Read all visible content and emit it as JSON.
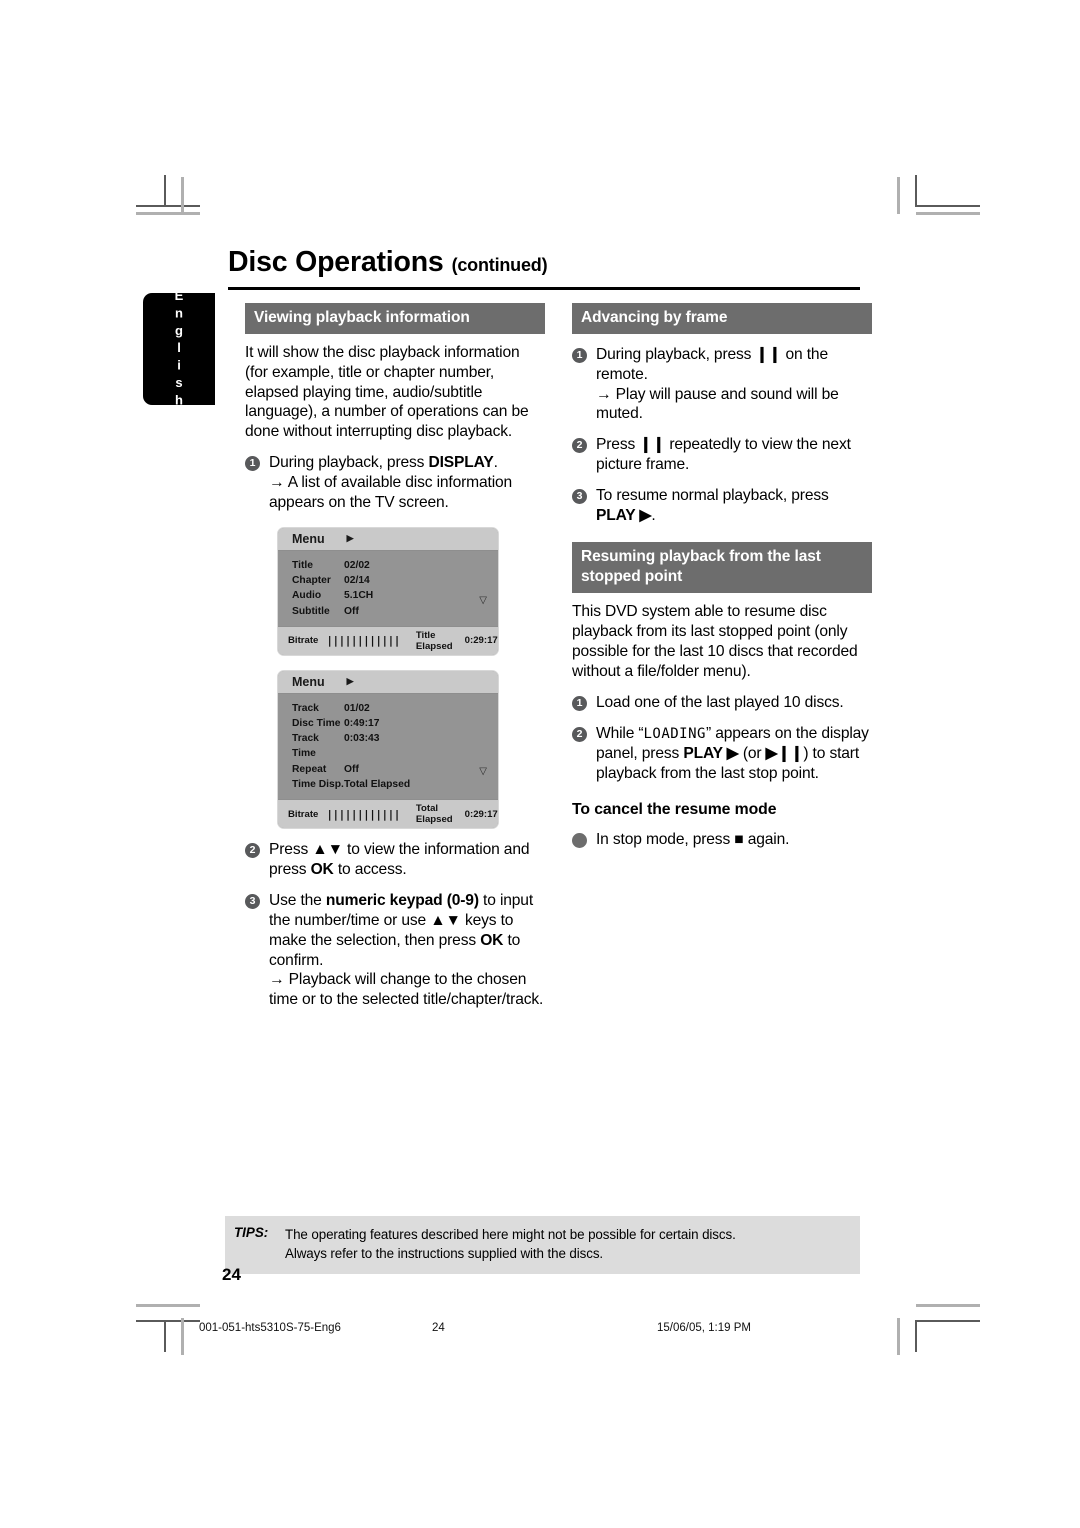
{
  "page": {
    "title_main": "Disc Operations",
    "title_cont": "(continued)",
    "language_tab": "English",
    "folio": "24"
  },
  "left_column": {
    "section_heading": "Viewing playback information",
    "intro": "It will show the disc playback information (for example, title or chapter number, elapsed playing time, audio/subtitle language), a number of operations can be done without interrupting disc playback.",
    "steps": [
      {
        "marker": "1",
        "text_parts": [
          {
            "t": "During playback, press ",
            "bold": false
          },
          {
            "t": "DISPLAY",
            "bold": true
          },
          {
            "t": ".",
            "bold": false
          }
        ],
        "sub": "→ A list of available disc information appears on the TV screen."
      },
      {
        "marker": "2",
        "text_parts": [
          {
            "t": "Press ",
            "bold": false
          },
          {
            "t": "▲▼",
            "bold": false
          },
          {
            "t": "  to view the information and press ",
            "bold": false
          },
          {
            "t": "OK",
            "bold": true
          },
          {
            "t": " to access.",
            "bold": false
          }
        ],
        "sub": ""
      },
      {
        "marker": "3",
        "text_parts": [
          {
            "t": "Use the ",
            "bold": false
          },
          {
            "t": "numeric keypad (0-9)",
            "bold": true
          },
          {
            "t": " to input the number/time or use ▲▼ keys to make the selection, then press ",
            "bold": false
          },
          {
            "t": "OK",
            "bold": true
          },
          {
            "t": " to confirm.",
            "bold": false
          }
        ],
        "sub": "→ Playback will change to the chosen time or to the selected title/chapter/track."
      }
    ],
    "osd_boxes": [
      {
        "header": "Menu",
        "header_arrow": "▶",
        "rows": [
          {
            "key": "Title",
            "value": "02/02"
          },
          {
            "key": "Chapter",
            "value": "02/14"
          },
          {
            "key": "Audio",
            "value": "5.1CH"
          },
          {
            "key": "Subtitle",
            "value": "Off"
          }
        ],
        "scroll_chevron": "▽",
        "footer_label": "Bitrate",
        "footer_bars": "||||||||||||",
        "footer_elapsed_label": "Title Elapsed",
        "footer_elapsed_value": "0:29:17"
      },
      {
        "header": "Menu",
        "header_arrow": "▶",
        "rows": [
          {
            "key": "Track",
            "value": "01/02"
          },
          {
            "key": "Disc Time",
            "value": "0:49:17"
          },
          {
            "key": "Track Time",
            "value": "0:03:43"
          },
          {
            "key": "Repeat",
            "value": "Off"
          },
          {
            "key": "Time Disp.",
            "value": "Total Elapsed"
          }
        ],
        "scroll_chevron": "▽",
        "footer_label": "Bitrate",
        "footer_bars": "||||||||||||",
        "footer_elapsed_label": "Total Elapsed",
        "footer_elapsed_value": "0:29:17"
      }
    ]
  },
  "right_column": {
    "section_heading_1": "Advancing by frame",
    "steps_1": [
      {
        "marker": "1",
        "text_parts": [
          {
            "t": "During playback, press ",
            "bold": false
          },
          {
            "t": "❙❙",
            "bold": true
          },
          {
            "t": " on the remote.",
            "bold": false
          }
        ],
        "sub": "→ Play will pause and sound will be muted."
      },
      {
        "marker": "2",
        "text_parts": [
          {
            "t": "Press ",
            "bold": false
          },
          {
            "t": "❙❙",
            "bold": true
          },
          {
            "t": "  repeatedly to view the next picture frame.",
            "bold": false
          }
        ],
        "sub": ""
      },
      {
        "marker": "3",
        "text_parts": [
          {
            "t": "To resume normal playback, press ",
            "bold": false
          },
          {
            "t": "PLAY ▶",
            "bold": true
          },
          {
            "t": ".",
            "bold": false
          }
        ],
        "sub": ""
      }
    ],
    "section_heading_2": "Resuming playback from the last stopped point",
    "intro_2": "This DVD system able to resume disc playback from its last stopped point (only possible for the last 10 discs that recorded without a file/folder menu).",
    "steps_2": [
      {
        "marker": "1",
        "text_parts": [
          {
            "t": "Load one of the last played 10 discs.",
            "bold": false
          }
        ],
        "sub": ""
      },
      {
        "marker": "2",
        "text_parts": [
          {
            "t": "While “",
            "bold": false
          },
          {
            "t": "LOADING",
            "bold": false,
            "lcd": true
          },
          {
            "t": "” appears on the display panel, press ",
            "bold": false
          },
          {
            "t": "PLAY ▶",
            "bold": true
          },
          {
            "t": " (or ",
            "bold": false
          },
          {
            "t": "▶❙❙",
            "bold": true
          },
          {
            "t": ") to start playback from the last stop point.",
            "bold": false
          }
        ],
        "sub": ""
      }
    ],
    "subheading": "To cancel the resume mode",
    "steps_3": [
      {
        "marker": "●",
        "dot": true,
        "text_parts": [
          {
            "t": "In stop mode, press ",
            "bold": false
          },
          {
            "t": "■",
            "bold": true
          },
          {
            "t": "  again.",
            "bold": false
          }
        ],
        "sub": ""
      }
    ]
  },
  "tips": {
    "label": "TIPS:",
    "line1": "The operating features described here might not be possible for certain discs.",
    "line2": "Always refer to the instructions supplied with the discs."
  },
  "printer_footer": {
    "filename": "001-051-hts5310S-75-Eng6",
    "page": "24",
    "timestamp": "15/06/05, 1:19 PM"
  },
  "colors": {
    "section_header_bg": "#6d6d6d",
    "tips_bg": "#dcdcdc",
    "osd_body_bg": "#949494",
    "osd_bar_bg": "#c9c9c9",
    "marker_bg": "#58595b"
  }
}
